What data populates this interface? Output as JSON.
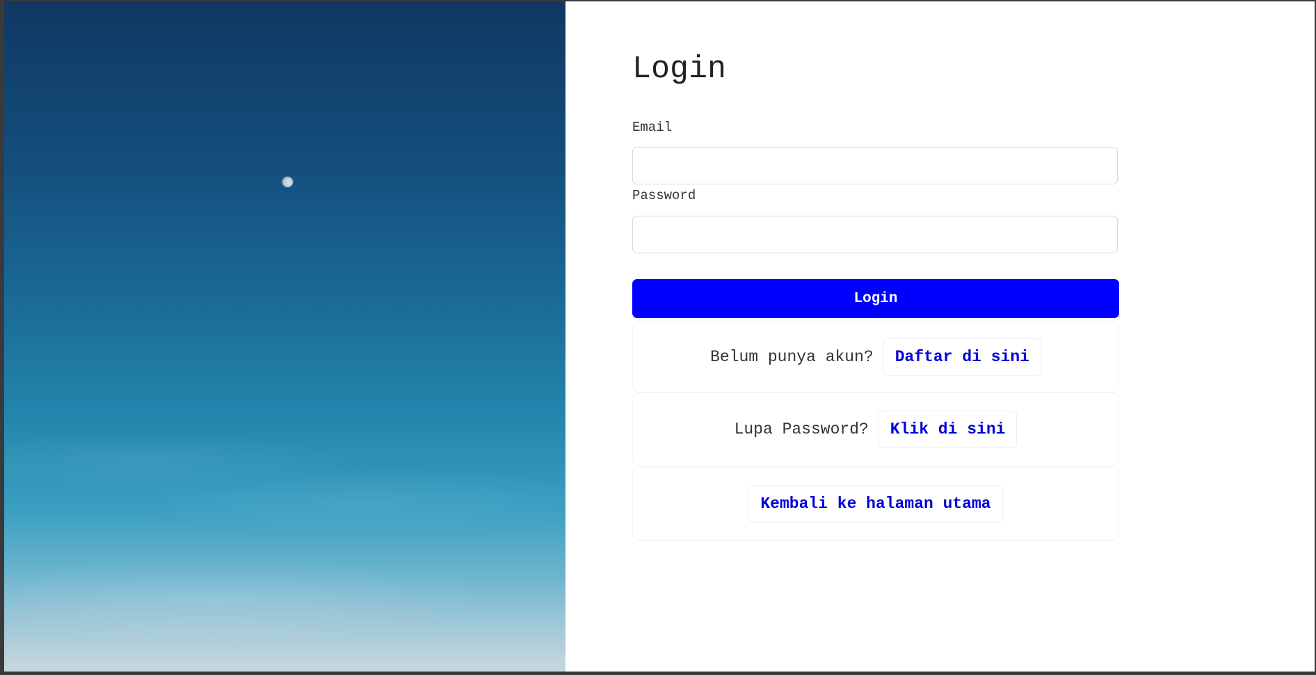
{
  "page": {
    "title": "Login"
  },
  "form": {
    "email_label": "Email",
    "email_value": "",
    "email_placeholder": "",
    "password_label": "Password",
    "password_value": "",
    "password_placeholder": "",
    "submit_label": "Login"
  },
  "links": {
    "register_prompt": "Belum punya akun?",
    "register_label": "Daftar di sini",
    "forgot_prompt": "Lupa Password?",
    "forgot_label": "Klik di sini",
    "home_label": "Kembali ke halaman utama"
  },
  "colors": {
    "primary_button": "#0000ff",
    "link": "#0000d8",
    "background_panel": "#ffffff"
  },
  "icons": {
    "hero_image": "sky-with-moon-image"
  }
}
